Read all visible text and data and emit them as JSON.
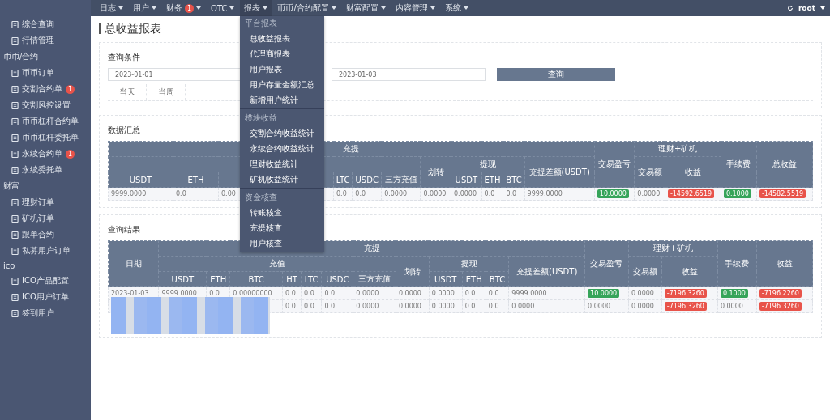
{
  "sidebar": {
    "groups": [
      {
        "items": [
          {
            "label": "综合查询"
          },
          {
            "label": "行情管理"
          }
        ]
      },
      {
        "title": "币币/合约",
        "items": [
          {
            "label": "币币订单"
          },
          {
            "label": "交割合约单",
            "badge": "1"
          },
          {
            "label": "交割风控设置"
          },
          {
            "label": "币币杠杆合约单"
          },
          {
            "label": "币币杠杆委托单"
          },
          {
            "label": "永续合约单",
            "badge": "1"
          },
          {
            "label": "永续委托单"
          }
        ]
      },
      {
        "title": "财富",
        "items": [
          {
            "label": "理财订单"
          },
          {
            "label": "矿机订单"
          },
          {
            "label": "跟单合约"
          },
          {
            "label": "私募用户订单"
          }
        ]
      },
      {
        "title": "ico",
        "items": [
          {
            "label": "ICO产品配置"
          },
          {
            "label": "ICO用户订单"
          },
          {
            "label": "签到用户"
          }
        ]
      }
    ]
  },
  "nav": [
    {
      "label": "日志",
      "expanded": false
    },
    {
      "label": "用户",
      "expanded": false
    },
    {
      "label": "财务",
      "badge": "1",
      "expanded": false
    },
    {
      "label": "OTC",
      "expanded": false
    },
    {
      "label": "报表",
      "expanded": true
    },
    {
      "label": "币币/合约配置",
      "expanded": false
    },
    {
      "label": "财富配置",
      "expanded": false
    },
    {
      "label": "内容管理",
      "expanded": false
    },
    {
      "label": "系统",
      "expanded": false
    }
  ],
  "user": "root",
  "menu": [
    {
      "title": "平台报表",
      "items": [
        "总收益报表",
        "代理商报表",
        "用户报表",
        "用户存量金额汇总",
        "新增用户统计"
      ]
    },
    {
      "title": "模块收益",
      "items": [
        "交割合约收益统计",
        "永续合约收益统计",
        "理财收益统计",
        "矿机收益统计"
      ]
    },
    {
      "title": "资金核查",
      "items": [
        "转账核查",
        "充提核查",
        "用户核查"
      ]
    }
  ],
  "page_title": "总收益报表",
  "query": {
    "title": "查询条件",
    "start_date": "2023-01-01",
    "end_date": "2023-01-03",
    "button": "查询",
    "tabs": [
      {
        "label": "当天",
        "selected": false
      },
      {
        "label": "当周",
        "selected": false
      }
    ]
  },
  "summary": {
    "title": "数据汇总",
    "header_rows": [
      [
        {
          "label": "充提",
          "colspan": 12
        },
        {
          "label": "交易盈亏",
          "rowspan": 3
        },
        {
          "label": "理财+矿机",
          "colspan": 2
        },
        {
          "label": "手续费",
          "rowspan": 3
        },
        {
          "label": "总收益",
          "rowspan": 3
        }
      ],
      [
        {
          "colspan": 7
        },
        {
          "label": "划转",
          "rowspan": 2
        },
        {
          "label": "提现",
          "colspan": 3
        },
        {
          "label": "充提差额(USDT)",
          "rowspan": 2
        },
        {
          "label": "交易额",
          "rowspan": 2
        },
        {
          "label": "收益",
          "rowspan": 2
        }
      ],
      [
        {
          "label": "USDT"
        },
        {
          "label": "ETH"
        },
        {},
        {},
        {
          "label": "LTC"
        },
        {
          "label": "USDC"
        },
        {
          "label": "三方充值"
        },
        {
          "label": "USDT"
        },
        {
          "label": "ETH"
        },
        {
          "label": "BTC"
        }
      ]
    ],
    "rows": [
      [
        "9999.0000",
        "0.0",
        "0.00",
        null,
        "0.0",
        "0.0",
        "0.0000",
        "0.0000",
        "0.0000",
        "0.0",
        "0.0",
        "9999.0000",
        {
          "text": "10.0000",
          "kind": "gain"
        },
        "0.0000",
        {
          "text": "-14592.6519",
          "kind": "loss"
        },
        {
          "text": "0.1000",
          "kind": "gain"
        },
        {
          "text": "-14582.5519",
          "kind": "loss"
        }
      ]
    ]
  },
  "results": {
    "title": "查询结果",
    "header_rows": [
      [
        {
          "label": "日期",
          "rowspan": 3
        },
        {
          "label": "充提",
          "colspan": 12
        },
        {
          "label": "交易盈亏",
          "rowspan": 3
        },
        {
          "label": "理财+矿机",
          "colspan": 2
        },
        {
          "label": "手续费",
          "rowspan": 3
        },
        {
          "label": "收益",
          "rowspan": 3
        }
      ],
      [
        {
          "label": "充值",
          "colspan": 7
        },
        {
          "label": "划转",
          "rowspan": 2
        },
        {
          "label": "提现",
          "colspan": 3
        },
        {
          "label": "充提差额(USDT)",
          "rowspan": 2
        },
        {
          "label": "交易额",
          "rowspan": 2
        },
        {
          "label": "收益",
          "rowspan": 2
        }
      ],
      [
        {
          "label": "USDT"
        },
        {
          "label": "ETH"
        },
        {
          "label": "BTC"
        },
        {
          "label": "HT"
        },
        {
          "label": "LTC"
        },
        {
          "label": "USDC"
        },
        {
          "label": "三方充值"
        },
        {
          "label": "USDT"
        },
        {
          "label": "ETH"
        },
        {
          "label": "BTC"
        }
      ]
    ],
    "rows": [
      [
        "2023-01-03",
        "9999.0000",
        "0.0",
        "0.00000000",
        "0.0",
        "0.0",
        "0.0",
        "0.0000",
        "0.0000",
        "0.0000",
        "0.0",
        "0.0",
        "9999.0000",
        {
          "text": "10.0000",
          "kind": "gain"
        },
        "0.0000",
        {
          "text": "-7196.3260",
          "kind": "loss"
        },
        {
          "text": "0.1000",
          "kind": "gain"
        },
        {
          "text": "-7196.2260",
          "kind": "loss"
        }
      ],
      [
        null,
        null,
        null,
        null,
        "0.0",
        "0.0",
        "0.0",
        "0.0000",
        "0.0000",
        "0.0000",
        "0.0",
        "0.0",
        "0.0000",
        "0.0000",
        "0.0000",
        {
          "text": "-7196.3260",
          "kind": "loss"
        },
        "0.0000",
        {
          "text": "-7196.3260",
          "kind": "loss"
        }
      ]
    ]
  }
}
